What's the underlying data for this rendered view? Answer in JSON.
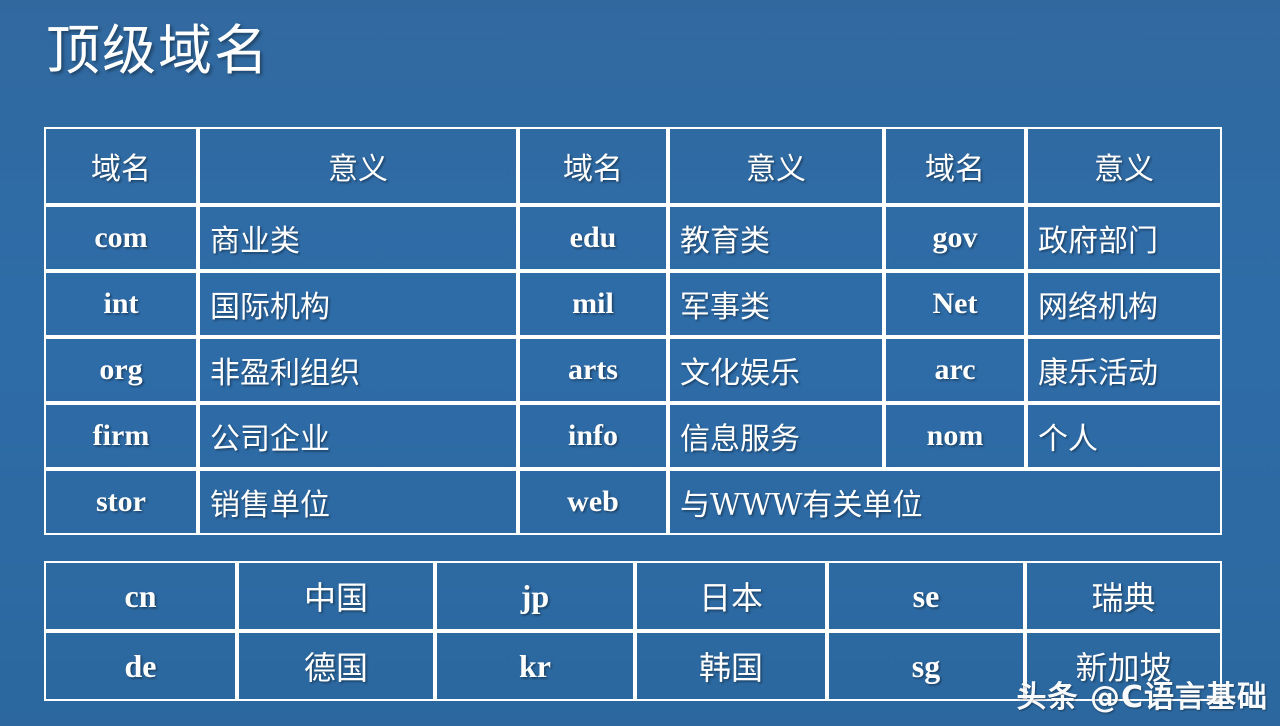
{
  "slide": {
    "title": "顶级域名",
    "background_color": "#2f6ba5",
    "border_color": "#ffffff",
    "text_color": "#ffffff"
  },
  "generic_table": {
    "headers": [
      "域名",
      "意义",
      "域名",
      "意义",
      "域名",
      "意义"
    ],
    "rows": [
      {
        "cells": [
          "com",
          "商业类",
          "edu",
          "教育类",
          "gov",
          "政府部门"
        ]
      },
      {
        "cells": [
          "int",
          "国际机构",
          "mil",
          "军事类",
          "Net",
          "网络机构"
        ]
      },
      {
        "cells": [
          "org",
          "非盈利组织",
          "arts",
          "文化娱乐",
          "arc",
          "康乐活动"
        ]
      },
      {
        "cells": [
          "firm",
          "公司企业",
          "info",
          "信息服务",
          "nom",
          "个人"
        ]
      }
    ],
    "last_row": {
      "code1": "stor",
      "meaning1": "销售单位",
      "code2": "web",
      "meaning_span": "与WWW有关单位"
    }
  },
  "country_table": {
    "rows": [
      {
        "cells": [
          "cn",
          "中国",
          "jp",
          "日本",
          "se",
          "瑞典"
        ]
      },
      {
        "cells": [
          "de",
          "德国",
          "kr",
          "韩国",
          "sg",
          "新加坡"
        ]
      }
    ]
  },
  "watermark": {
    "text": "头条 @C语言基础"
  }
}
